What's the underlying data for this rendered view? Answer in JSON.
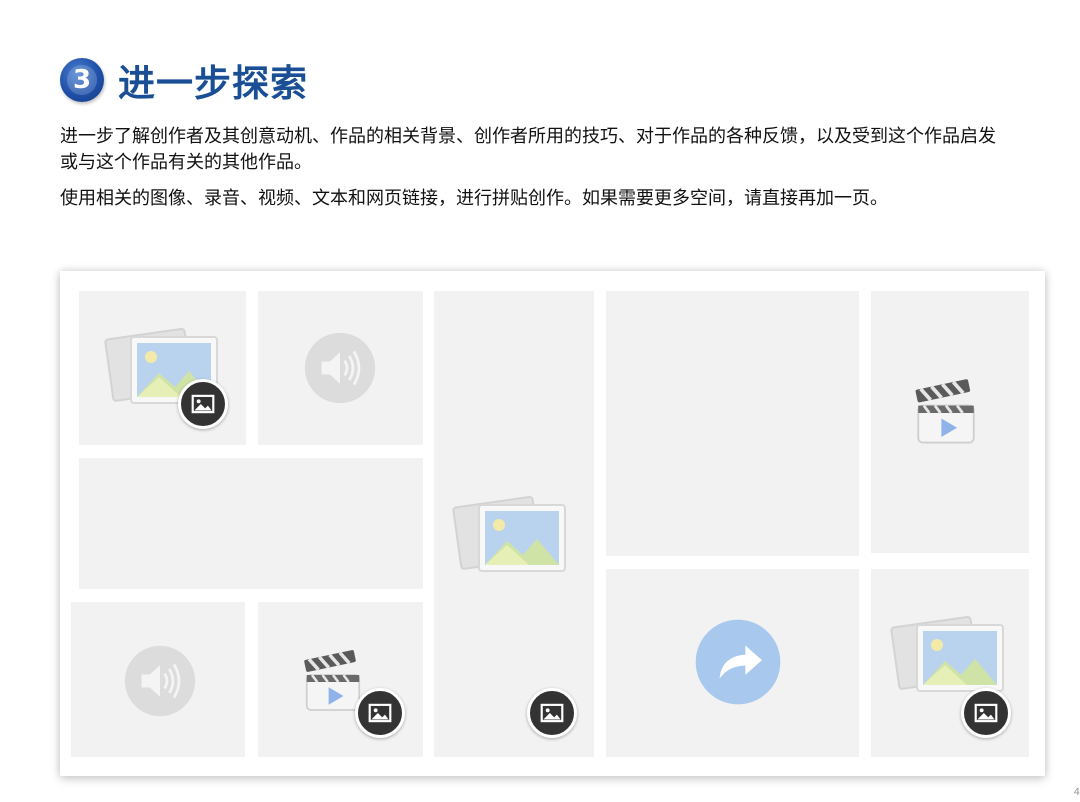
{
  "header": {
    "step_number": "3",
    "title": "进一步探索"
  },
  "body": {
    "paragraph_1": "进一步了解创作者及其创意动机、作品的相关背景、创作者所用的技巧、对于作品的各种反馈，以及受到这个作品启发或与这个作品有关的其他作品。",
    "paragraph_2": "使用相关的图像、录音、视频、文本和网页链接，进行拼贴创作。如果需要更多空间，请直接再加一页。"
  },
  "collage": {
    "tiles": [
      {
        "name": "tile-image-1",
        "icon": "image-placeholder-icon",
        "badge": "image-badge-icon"
      },
      {
        "name": "tile-audio-1",
        "icon": "audio-speaker-icon"
      },
      {
        "name": "tile-image-tall",
        "icon": "image-placeholder-icon",
        "badge": "image-badge-icon"
      },
      {
        "name": "tile-blank-large"
      },
      {
        "name": "tile-video-1",
        "icon": "video-clapper-icon"
      },
      {
        "name": "tile-blank-wide"
      },
      {
        "name": "tile-audio-2",
        "icon": "audio-speaker-icon"
      },
      {
        "name": "tile-video-2",
        "icon": "video-clapper-icon",
        "badge": "image-badge-icon"
      },
      {
        "name": "tile-link",
        "icon": "share-link-icon"
      },
      {
        "name": "tile-image-2",
        "icon": "image-placeholder-icon",
        "badge": "image-badge-icon"
      }
    ],
    "colors": {
      "tile_bg": "#f2f2f2",
      "badge_bg": "#333333",
      "title_blue": "#1a4f95",
      "link_blue": "#a9c8ee"
    }
  },
  "footer": {
    "page_mark": "4"
  }
}
